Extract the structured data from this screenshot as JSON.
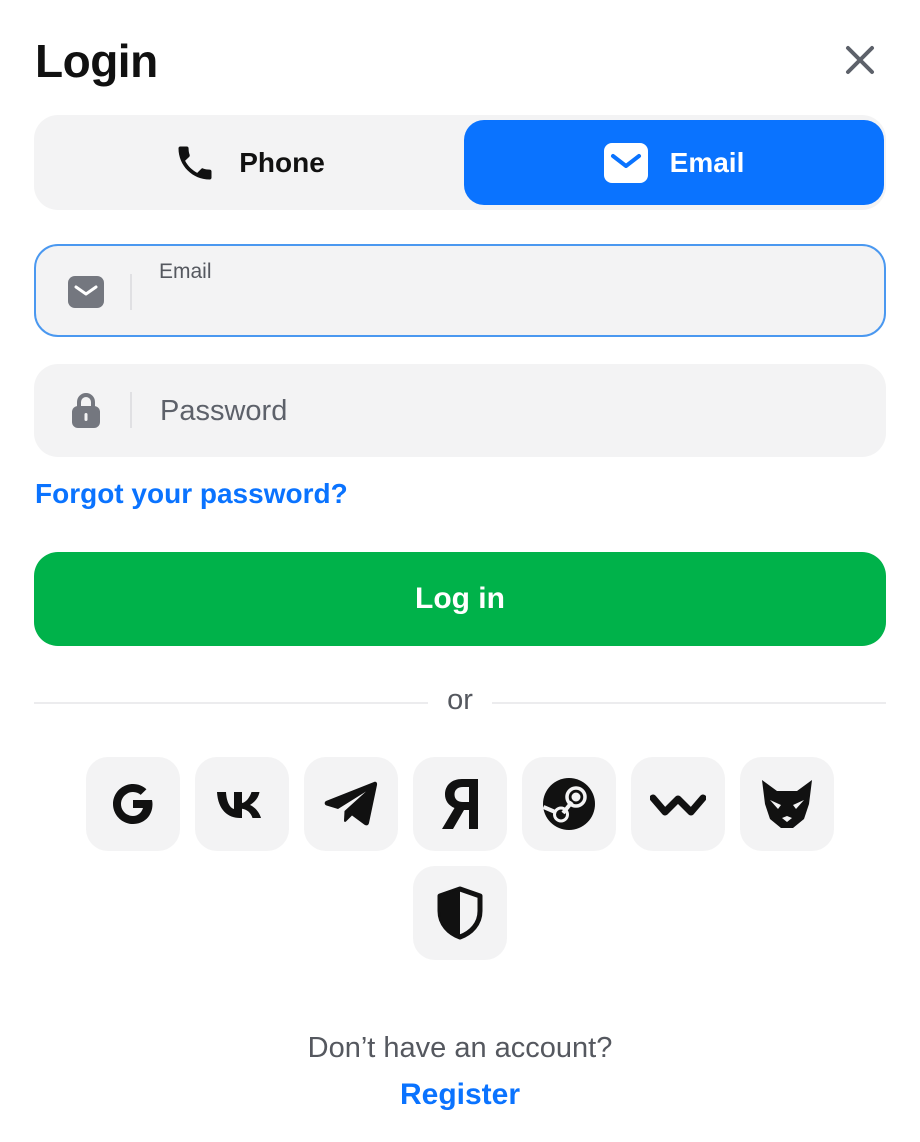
{
  "dialog": {
    "title": "Login",
    "close_icon": "close-icon"
  },
  "tabs": [
    {
      "label": "Phone",
      "icon": "phone-icon",
      "selected": false
    },
    {
      "label": "Email",
      "icon": "mail-icon",
      "selected": true
    }
  ],
  "email_field": {
    "label": "Email",
    "value": "",
    "icon": "mail-icon"
  },
  "password_field": {
    "placeholder": "Password",
    "value": "",
    "icon": "lock-icon"
  },
  "forgot_password": "Forgot your password?",
  "login_button": "Log in",
  "separator": "or",
  "social_providers": [
    "google-icon",
    "vk-icon",
    "telegram-icon",
    "yandex-icon",
    "steam-icon",
    "walletconnect-icon",
    "metamask-icon",
    "shield-icon"
  ],
  "footer": {
    "question": "Don’t have an account?",
    "register_link": "Register"
  },
  "colors": {
    "accent": "#0a73ff",
    "login_button": "#00b24a",
    "field_background": "#f3f3f4",
    "focus_border": "#4a98f0"
  }
}
